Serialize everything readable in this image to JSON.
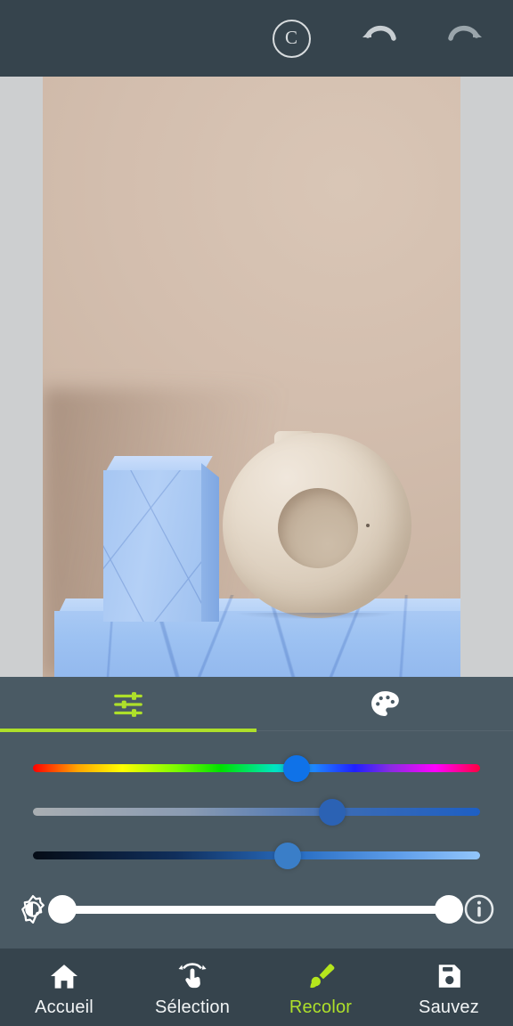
{
  "app": {
    "accent_green": "#aee02a",
    "toolbar_bg": "#36444d",
    "panel_bg": "#4a5a64",
    "canvas_bg": "#cdcfd0"
  },
  "topbar": {
    "copyright_label": "C",
    "copyright_name": "copyright-badge",
    "undo_name": "undo-icon",
    "redo_name": "redo-icon"
  },
  "canvas": {
    "image_description": "Cream donut-shaped ceramic vase on blue marble blocks against a beige wall"
  },
  "panel": {
    "tabs": [
      {
        "name": "tab-adjustments",
        "icon": "sliders-icon",
        "active": true
      },
      {
        "name": "tab-palette",
        "icon": "palette-icon",
        "active": false
      }
    ],
    "sliders": [
      {
        "name": "hue-slider",
        "icon": "hue-gradient",
        "value": 59
      },
      {
        "name": "saturation-slider",
        "icon": "saturation-gradient",
        "value": 67
      },
      {
        "name": "brightness-slider",
        "icon": "brightness-gradient",
        "value": 57
      }
    ],
    "opacity_row": {
      "left_icon": "brightness-contrast-icon",
      "right_icon": "info-icon",
      "range_name": "opacity-range-slider",
      "low": 0,
      "high": 100
    }
  },
  "nav": {
    "items": [
      {
        "label": "Accueil",
        "icon": "home-icon",
        "active": false
      },
      {
        "label": "Sélection",
        "icon": "tap-hand-icon",
        "active": false
      },
      {
        "label": "Recolor",
        "icon": "paintbrush-icon",
        "active": true
      },
      {
        "label": "Sauvez",
        "icon": "save-disk-icon",
        "active": false
      }
    ]
  }
}
